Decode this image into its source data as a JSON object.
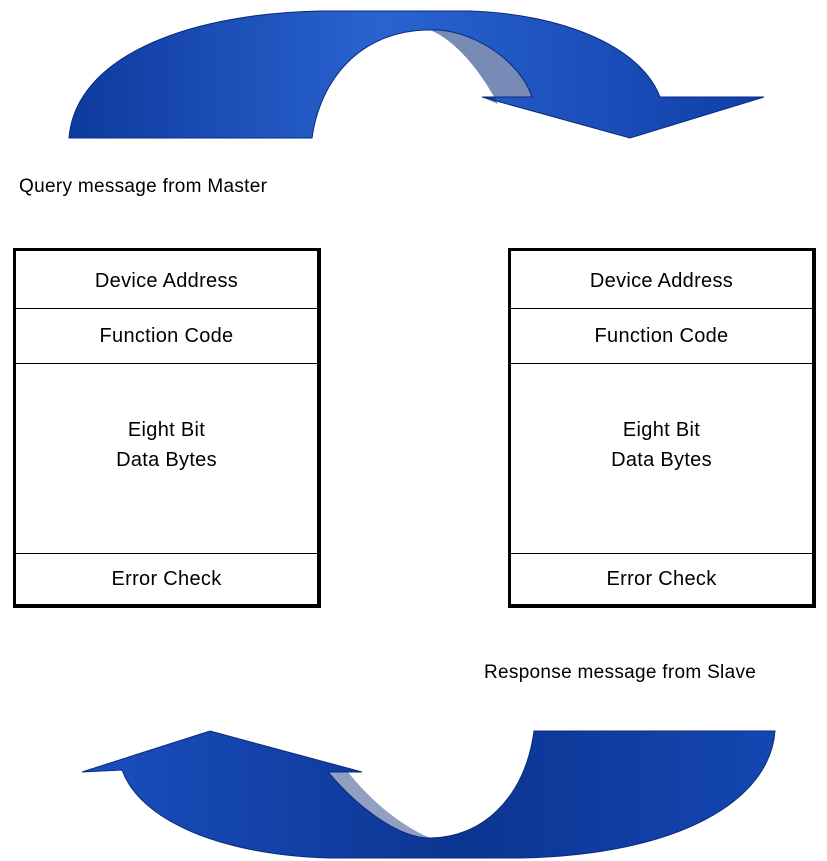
{
  "colors": {
    "arrow_fill": "#1448b4",
    "arrow_dark": "#0a2e86",
    "arrow_light": "#2f6ad6",
    "frame_border": "#000000",
    "background": "#ffffff"
  },
  "arrows": {
    "top": {
      "icon": "curved-arrow-right-icon",
      "direction": "left-to-right"
    },
    "bottom": {
      "icon": "curved-arrow-left-icon",
      "direction": "right-to-left"
    }
  },
  "query": {
    "caption": "Query message from Master",
    "fields": {
      "address": "Device Address",
      "function": "Function Code",
      "data": "Eight Bit\nData Bytes",
      "error": "Error Check"
    }
  },
  "response": {
    "caption": "Response message from Slave",
    "fields": {
      "address": "Device Address",
      "function": "Function Code",
      "data": "Eight Bit\nData Bytes",
      "error": "Error Check"
    }
  }
}
